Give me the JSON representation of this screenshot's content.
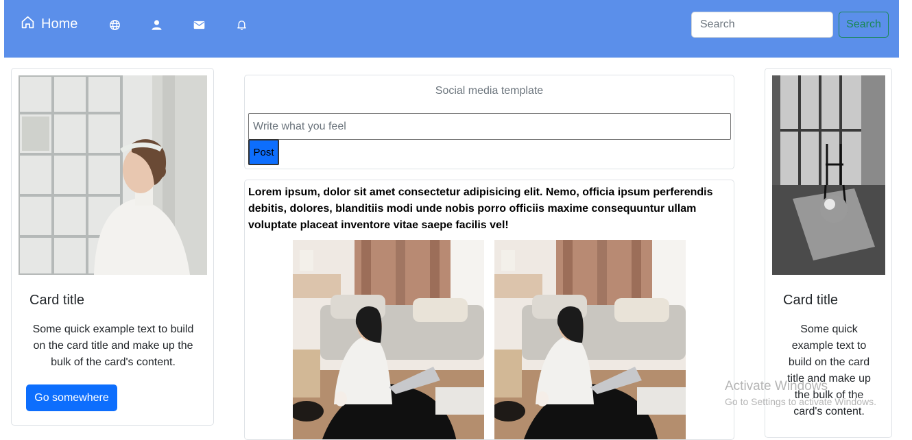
{
  "navbar": {
    "home_label": "Home",
    "icons": [
      "home-icon",
      "globe-icon",
      "person-icon",
      "envelope-icon",
      "bell-icon"
    ],
    "search_placeholder": "Search",
    "search_button_label": "Search",
    "background_color": "#5b8fea"
  },
  "left_card": {
    "image": "woman-by-window-photo",
    "title": "Card title",
    "text": "Some quick example text to build on the card title and make up the bulk of the card's content.",
    "button_label": "Go somewhere",
    "button_color": "#0d6efd"
  },
  "right_card": {
    "image": "chair-room-bw-photo",
    "title": "Card title",
    "text": "Some quick example text to build on the card title and make up the bulk of the card's content."
  },
  "composer": {
    "heading": "Social media template",
    "input_placeholder": "Write what you feel",
    "post_button_label": "Post"
  },
  "feed": {
    "post_text": "Lorem ipsum, dolor sit amet consectetur adipisicing elit. Nemo, officia ipsum perferendis debitis, dolores, blanditiis modi unde nobis porro officiis maxime consequuntur ullam voluptate placeat inventore vitae saepe facilis vel!",
    "images": [
      "woman-laptop-photo",
      "woman-laptop-photo"
    ]
  },
  "watermark": {
    "title": "Activate Windows",
    "subtitle": "Go to Settings to activate Windows."
  }
}
